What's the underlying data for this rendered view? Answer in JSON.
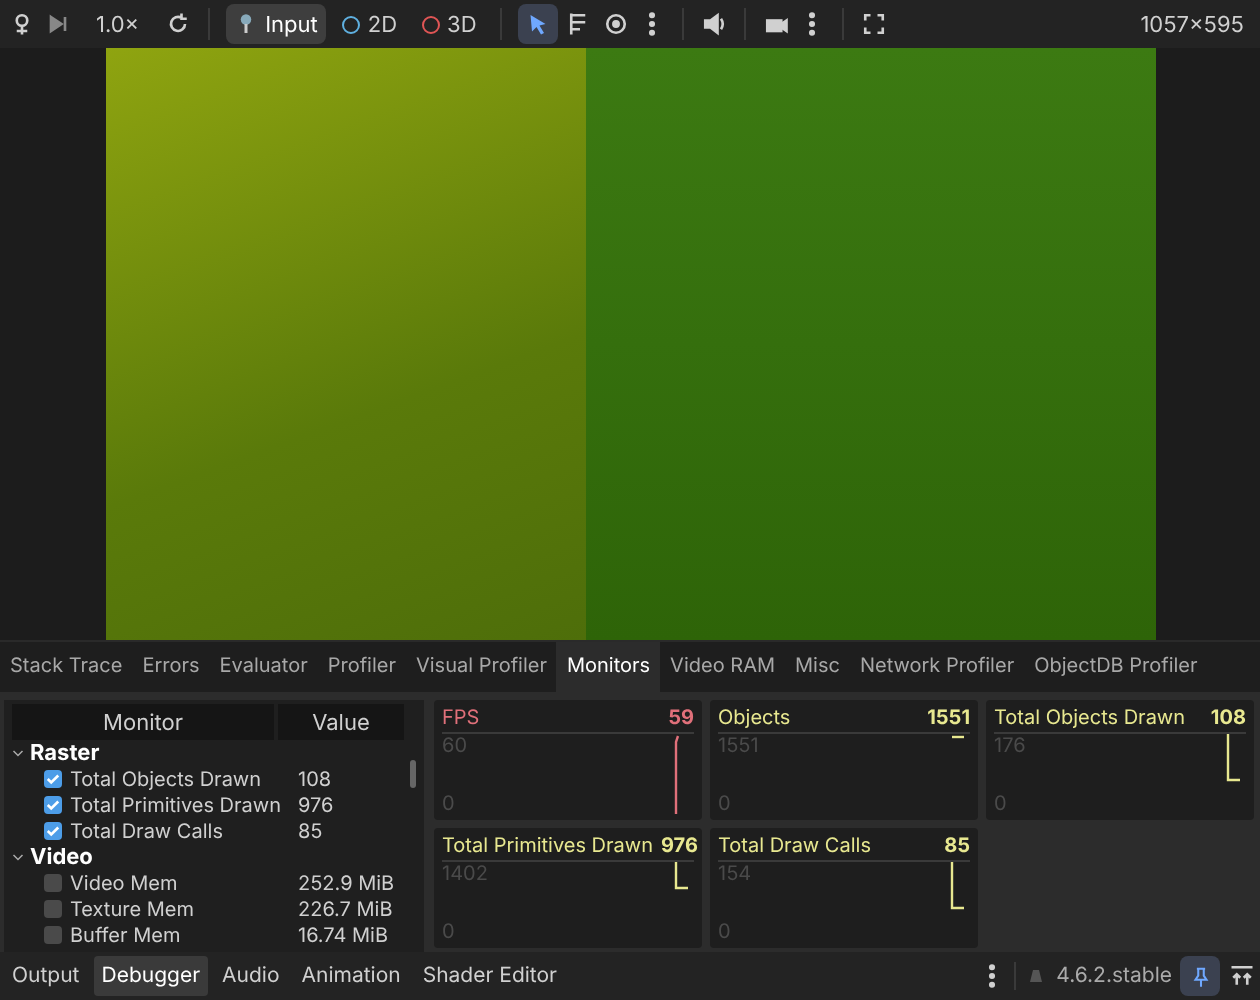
{
  "toolbar": {
    "zoom": "1.0×",
    "input": {
      "label": "Input",
      "selected": true
    },
    "modes": [
      {
        "label": "2D",
        "color": "#5fb0e0"
      },
      {
        "label": "3D",
        "color": "#e05555"
      }
    ],
    "select_tool": {
      "selected": true
    },
    "resolution": "1057x595"
  },
  "debugger_tabs": [
    {
      "label": "Stack Trace",
      "selected": false
    },
    {
      "label": "Errors",
      "selected": false
    },
    {
      "label": "Evaluator",
      "selected": false
    },
    {
      "label": "Profiler",
      "selected": false
    },
    {
      "label": "Visual Profiler",
      "selected": false
    },
    {
      "label": "Monitors",
      "selected": true
    },
    {
      "label": "Video RAM",
      "selected": false
    },
    {
      "label": "Misc",
      "selected": false
    },
    {
      "label": "Network Profiler",
      "selected": false
    },
    {
      "label": "ObjectDB Profiler",
      "selected": false
    }
  ],
  "monitor_table": {
    "columns": [
      "Monitor",
      "Value"
    ],
    "groups": [
      {
        "name": "Raster",
        "expanded": true,
        "children": [
          {
            "name": "Total Objects Drawn",
            "value": "108",
            "checked": true
          },
          {
            "name": "Total Primitives Drawn",
            "value": "976",
            "checked": true
          },
          {
            "name": "Total Draw Calls",
            "value": "85",
            "checked": true
          }
        ]
      },
      {
        "name": "Video",
        "expanded": true,
        "children": [
          {
            "name": "Video Mem",
            "value": "252.9 MiB",
            "checked": false
          },
          {
            "name": "Texture Mem",
            "value": "226.7 MiB",
            "checked": false
          },
          {
            "name": "Buffer Mem",
            "value": "16.74 MiB",
            "checked": false
          }
        ]
      }
    ]
  },
  "graphs": [
    {
      "title": "FPS",
      "value": "59",
      "max": "60",
      "min": "0",
      "color": "#e0707a"
    },
    {
      "title": "Objects",
      "value": "1551",
      "max": "1551",
      "min": "0",
      "color": "#e8e890"
    },
    {
      "title": "Total Objects Drawn",
      "value": "108",
      "max": "176",
      "min": "0",
      "color": "#e8e890"
    },
    {
      "title": "Total Primitives Drawn",
      "value": "976",
      "max": "1402",
      "min": "0",
      "color": "#e8e890"
    },
    {
      "title": "Total Draw Calls",
      "value": "85",
      "max": "154",
      "min": "0",
      "color": "#e8e890"
    }
  ],
  "bottom_tabs": [
    {
      "label": "Output",
      "selected": false
    },
    {
      "label": "Debugger",
      "selected": true
    },
    {
      "label": "Audio",
      "selected": false
    },
    {
      "label": "Animation",
      "selected": false
    },
    {
      "label": "Shader Editor",
      "selected": false
    }
  ],
  "version": "4.6.2.stable",
  "pinned": true
}
